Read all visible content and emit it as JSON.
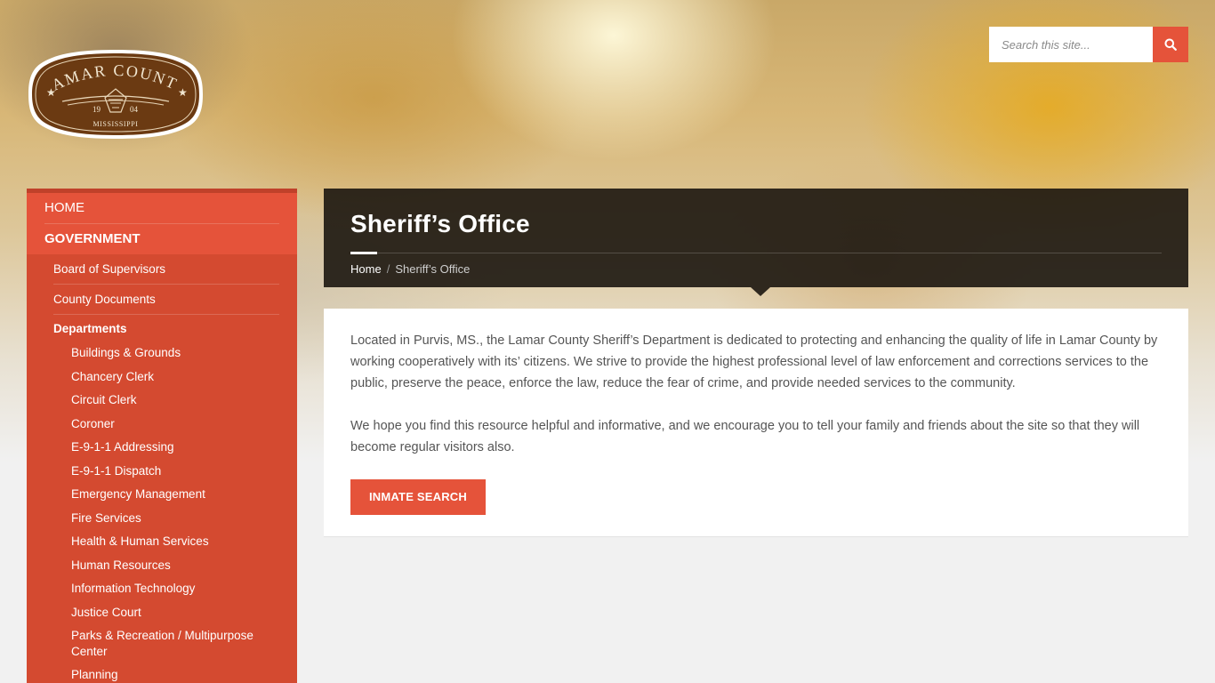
{
  "header": {
    "logo": {
      "text_top": "LAMAR COUNTY",
      "year_left": "19",
      "year_right": "04",
      "state": "MISSISSIPPI"
    },
    "search": {
      "placeholder": "Search this site...",
      "icon": "search-icon"
    }
  },
  "sidebar": {
    "top_items": [
      {
        "label": "HOME"
      },
      {
        "label": "GOVERNMENT",
        "active": true
      }
    ],
    "sub_items": [
      {
        "label": "Board of Supervisors"
      },
      {
        "label": "County Documents"
      }
    ],
    "departments_heading": "Departments",
    "departments": [
      {
        "label": "Buildings & Grounds"
      },
      {
        "label": "Chancery Clerk"
      },
      {
        "label": "Circuit Clerk"
      },
      {
        "label": "Coroner"
      },
      {
        "label": "E-9-1-1 Addressing"
      },
      {
        "label": "E-9-1-1 Dispatch"
      },
      {
        "label": "Emergency Management"
      },
      {
        "label": "Fire Services"
      },
      {
        "label": "Health & Human Services"
      },
      {
        "label": "Human Resources"
      },
      {
        "label": "Information Technology"
      },
      {
        "label": "Justice Court"
      },
      {
        "label": "Parks & Recreation / Multipurpose Center"
      },
      {
        "label": "Planning"
      }
    ]
  },
  "main": {
    "title": "Sheriff’s Office",
    "breadcrumb": {
      "home": "Home",
      "separator": "/",
      "current": "Sheriff’s Office"
    },
    "paragraphs": [
      "Located in Purvis, MS., the Lamar County Sheriff’s Department is dedicated to protecting and enhancing the quality of life in Lamar County by working cooperatively with its’ citizens. We strive to provide the highest professional level of law enforcement and corrections services to the public, preserve the peace, enforce the law, reduce the fear of crime, and provide needed services to the community.",
      "We hope you find this resource helpful and informative, and we encourage you to tell your family and friends about the site so that they will become regular visitors also."
    ],
    "button_label": "INMATE SEARCH"
  },
  "colors": {
    "accent": "#e5533a",
    "sidebar": "#d44a30",
    "title_box": "#1c1610",
    "logo_brown": "#6b3a12"
  }
}
